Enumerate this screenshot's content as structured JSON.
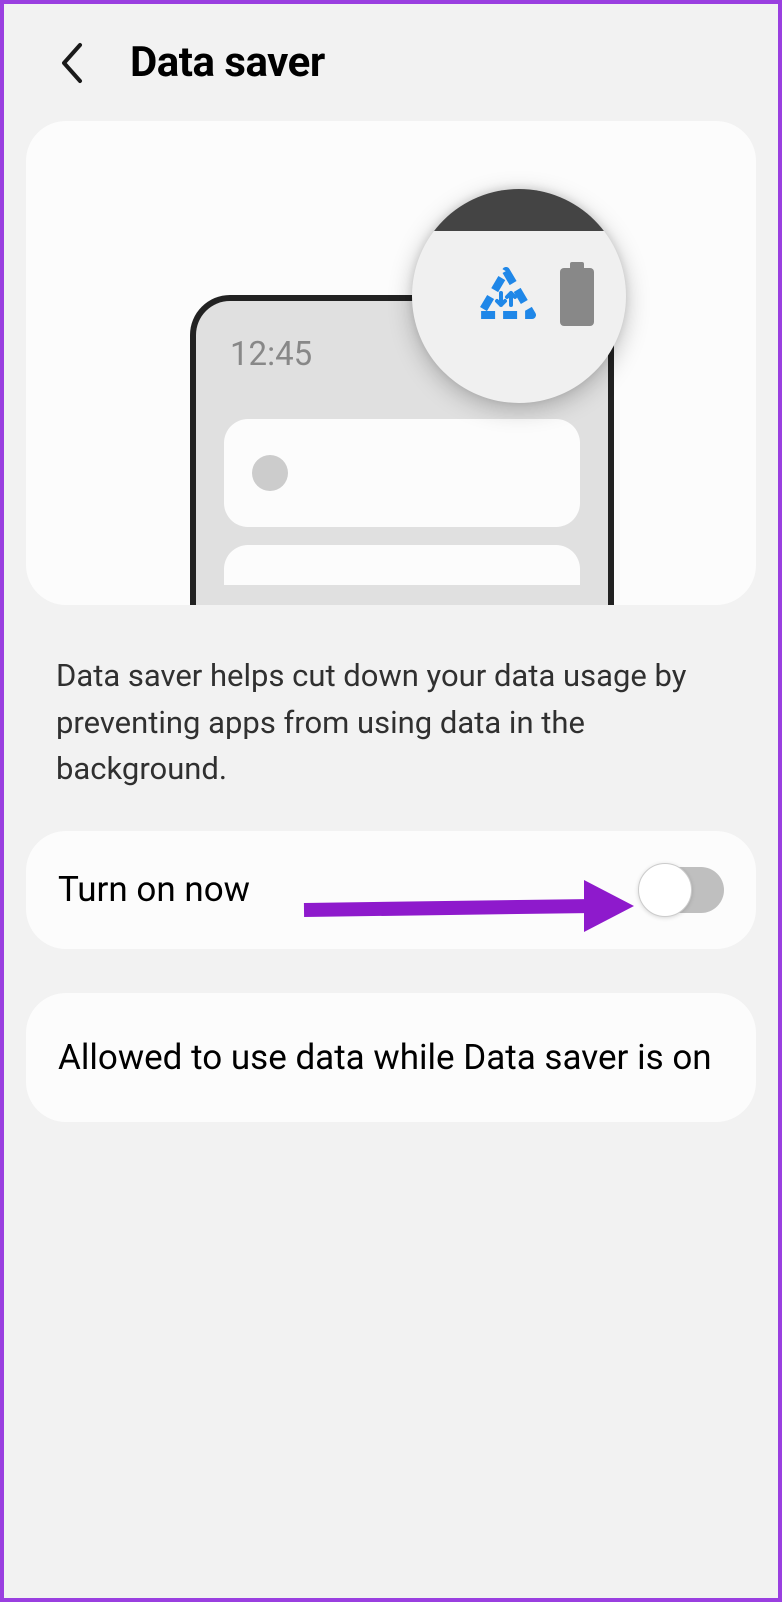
{
  "header": {
    "title": "Data saver"
  },
  "illustration": {
    "phone_time": "12:45"
  },
  "description": "Data saver helps cut down your data usage by preventing apps from using data in the background.",
  "toggle": {
    "label": "Turn on now",
    "enabled": false
  },
  "link": {
    "label": "Allowed to use data while Data saver is on"
  }
}
